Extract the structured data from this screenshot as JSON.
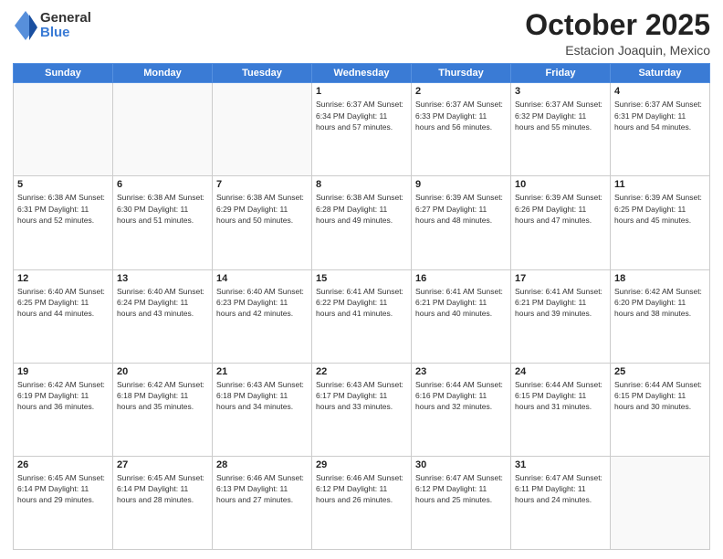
{
  "header": {
    "logo_general": "General",
    "logo_blue": "Blue",
    "month_title": "October 2025",
    "subtitle": "Estacion Joaquin, Mexico"
  },
  "days_of_week": [
    "Sunday",
    "Monday",
    "Tuesday",
    "Wednesday",
    "Thursday",
    "Friday",
    "Saturday"
  ],
  "weeks": [
    [
      {
        "day": "",
        "info": ""
      },
      {
        "day": "",
        "info": ""
      },
      {
        "day": "",
        "info": ""
      },
      {
        "day": "1",
        "info": "Sunrise: 6:37 AM\nSunset: 6:34 PM\nDaylight: 11 hours and 57 minutes."
      },
      {
        "day": "2",
        "info": "Sunrise: 6:37 AM\nSunset: 6:33 PM\nDaylight: 11 hours and 56 minutes."
      },
      {
        "day": "3",
        "info": "Sunrise: 6:37 AM\nSunset: 6:32 PM\nDaylight: 11 hours and 55 minutes."
      },
      {
        "day": "4",
        "info": "Sunrise: 6:37 AM\nSunset: 6:31 PM\nDaylight: 11 hours and 54 minutes."
      }
    ],
    [
      {
        "day": "5",
        "info": "Sunrise: 6:38 AM\nSunset: 6:31 PM\nDaylight: 11 hours and 52 minutes."
      },
      {
        "day": "6",
        "info": "Sunrise: 6:38 AM\nSunset: 6:30 PM\nDaylight: 11 hours and 51 minutes."
      },
      {
        "day": "7",
        "info": "Sunrise: 6:38 AM\nSunset: 6:29 PM\nDaylight: 11 hours and 50 minutes."
      },
      {
        "day": "8",
        "info": "Sunrise: 6:38 AM\nSunset: 6:28 PM\nDaylight: 11 hours and 49 minutes."
      },
      {
        "day": "9",
        "info": "Sunrise: 6:39 AM\nSunset: 6:27 PM\nDaylight: 11 hours and 48 minutes."
      },
      {
        "day": "10",
        "info": "Sunrise: 6:39 AM\nSunset: 6:26 PM\nDaylight: 11 hours and 47 minutes."
      },
      {
        "day": "11",
        "info": "Sunrise: 6:39 AM\nSunset: 6:25 PM\nDaylight: 11 hours and 45 minutes."
      }
    ],
    [
      {
        "day": "12",
        "info": "Sunrise: 6:40 AM\nSunset: 6:25 PM\nDaylight: 11 hours and 44 minutes."
      },
      {
        "day": "13",
        "info": "Sunrise: 6:40 AM\nSunset: 6:24 PM\nDaylight: 11 hours and 43 minutes."
      },
      {
        "day": "14",
        "info": "Sunrise: 6:40 AM\nSunset: 6:23 PM\nDaylight: 11 hours and 42 minutes."
      },
      {
        "day": "15",
        "info": "Sunrise: 6:41 AM\nSunset: 6:22 PM\nDaylight: 11 hours and 41 minutes."
      },
      {
        "day": "16",
        "info": "Sunrise: 6:41 AM\nSunset: 6:21 PM\nDaylight: 11 hours and 40 minutes."
      },
      {
        "day": "17",
        "info": "Sunrise: 6:41 AM\nSunset: 6:21 PM\nDaylight: 11 hours and 39 minutes."
      },
      {
        "day": "18",
        "info": "Sunrise: 6:42 AM\nSunset: 6:20 PM\nDaylight: 11 hours and 38 minutes."
      }
    ],
    [
      {
        "day": "19",
        "info": "Sunrise: 6:42 AM\nSunset: 6:19 PM\nDaylight: 11 hours and 36 minutes."
      },
      {
        "day": "20",
        "info": "Sunrise: 6:42 AM\nSunset: 6:18 PM\nDaylight: 11 hours and 35 minutes."
      },
      {
        "day": "21",
        "info": "Sunrise: 6:43 AM\nSunset: 6:18 PM\nDaylight: 11 hours and 34 minutes."
      },
      {
        "day": "22",
        "info": "Sunrise: 6:43 AM\nSunset: 6:17 PM\nDaylight: 11 hours and 33 minutes."
      },
      {
        "day": "23",
        "info": "Sunrise: 6:44 AM\nSunset: 6:16 PM\nDaylight: 11 hours and 32 minutes."
      },
      {
        "day": "24",
        "info": "Sunrise: 6:44 AM\nSunset: 6:15 PM\nDaylight: 11 hours and 31 minutes."
      },
      {
        "day": "25",
        "info": "Sunrise: 6:44 AM\nSunset: 6:15 PM\nDaylight: 11 hours and 30 minutes."
      }
    ],
    [
      {
        "day": "26",
        "info": "Sunrise: 6:45 AM\nSunset: 6:14 PM\nDaylight: 11 hours and 29 minutes."
      },
      {
        "day": "27",
        "info": "Sunrise: 6:45 AM\nSunset: 6:14 PM\nDaylight: 11 hours and 28 minutes."
      },
      {
        "day": "28",
        "info": "Sunrise: 6:46 AM\nSunset: 6:13 PM\nDaylight: 11 hours and 27 minutes."
      },
      {
        "day": "29",
        "info": "Sunrise: 6:46 AM\nSunset: 6:12 PM\nDaylight: 11 hours and 26 minutes."
      },
      {
        "day": "30",
        "info": "Sunrise: 6:47 AM\nSunset: 6:12 PM\nDaylight: 11 hours and 25 minutes."
      },
      {
        "day": "31",
        "info": "Sunrise: 6:47 AM\nSunset: 6:11 PM\nDaylight: 11 hours and 24 minutes."
      },
      {
        "day": "",
        "info": ""
      }
    ]
  ]
}
